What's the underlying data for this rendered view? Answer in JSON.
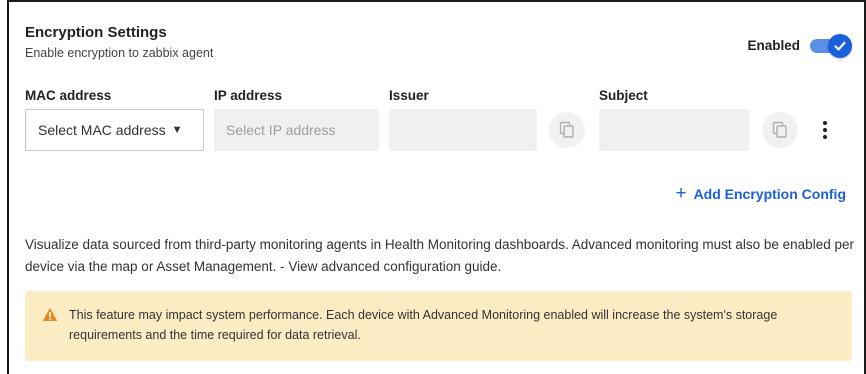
{
  "header": {
    "title": "Encryption Settings",
    "subtitle": "Enable encryption to zabbix agent",
    "enabled_label": "Enabled",
    "enabled": true
  },
  "columns": {
    "mac": "MAC address",
    "ip": "IP address",
    "issuer": "Issuer",
    "subject": "Subject"
  },
  "fields": {
    "mac_select_value": "Select MAC address",
    "ip_placeholder": "Select IP address",
    "issuer_value": "",
    "subject_value": ""
  },
  "actions": {
    "add_config_label": "Add Encryption Config"
  },
  "description": "Visualize data sourced from third-party monitoring agents in Health Monitoring dashboards. Advanced monitoring must also be enabled per device via the map or Asset Management. - View advanced configuration guide.",
  "warning": {
    "text": "This feature may impact system performance. Each device with Advanced Monitoring enabled will increase the system's storage requirements and the time required for data retrieval."
  },
  "colors": {
    "accent": "#1a5fdb",
    "warning_bg": "#fcecc4",
    "warning_icon": "#e8871e"
  }
}
